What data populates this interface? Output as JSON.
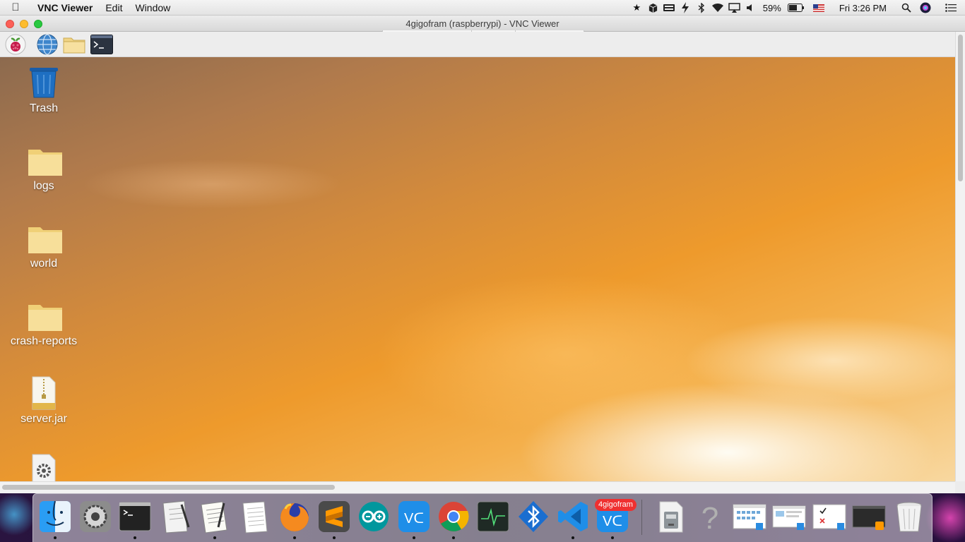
{
  "menubar": {
    "app_name": "VNC Viewer",
    "menus": [
      "Edit",
      "Window"
    ],
    "battery": "59%",
    "clock": "Fri 3:26 PM"
  },
  "window": {
    "title": "4gigofram (raspberrypi) - VNC Viewer"
  },
  "pi_taskbar": {
    "items": [
      "raspberry-menu-icon",
      "web-browser-icon",
      "file-manager-icon",
      "terminal-icon"
    ]
  },
  "desktop": {
    "icons": [
      {
        "label": "Trash",
        "icon": "trash-icon"
      },
      {
        "label": "logs",
        "icon": "folder-icon"
      },
      {
        "label": "world",
        "icon": "folder-icon"
      },
      {
        "label": "crash-reports",
        "icon": "folder-icon"
      },
      {
        "label": "server.jar",
        "icon": "archive-icon"
      },
      {
        "label": "",
        "icon": "settings-file-icon"
      }
    ]
  },
  "dock": {
    "apps": [
      "finder-icon",
      "system-preferences-icon",
      "terminal-icon",
      "script-editor-icon",
      "textedit-icon",
      "notes-icon",
      "firefox-icon",
      "sublime-text-icon",
      "arduino-icon",
      "vnc-viewer-icon",
      "chrome-icon",
      "activity-monitor-icon",
      "bluetooth-icon",
      "vscode-icon",
      "vnc-viewer-window-icon"
    ],
    "badge": "4gigofram",
    "others": [
      "downloads-stack-icon",
      "help-icon",
      "screenshot-icon",
      "screenshot-icon",
      "screenshot-icon",
      "sublime-window-icon",
      "trash-icon"
    ]
  },
  "colors": {
    "close": "#fc5f57",
    "minimize": "#fdbc2e",
    "maximize": "#28c840",
    "folder": "#f4d88a",
    "trash": "#1e6fc2"
  }
}
